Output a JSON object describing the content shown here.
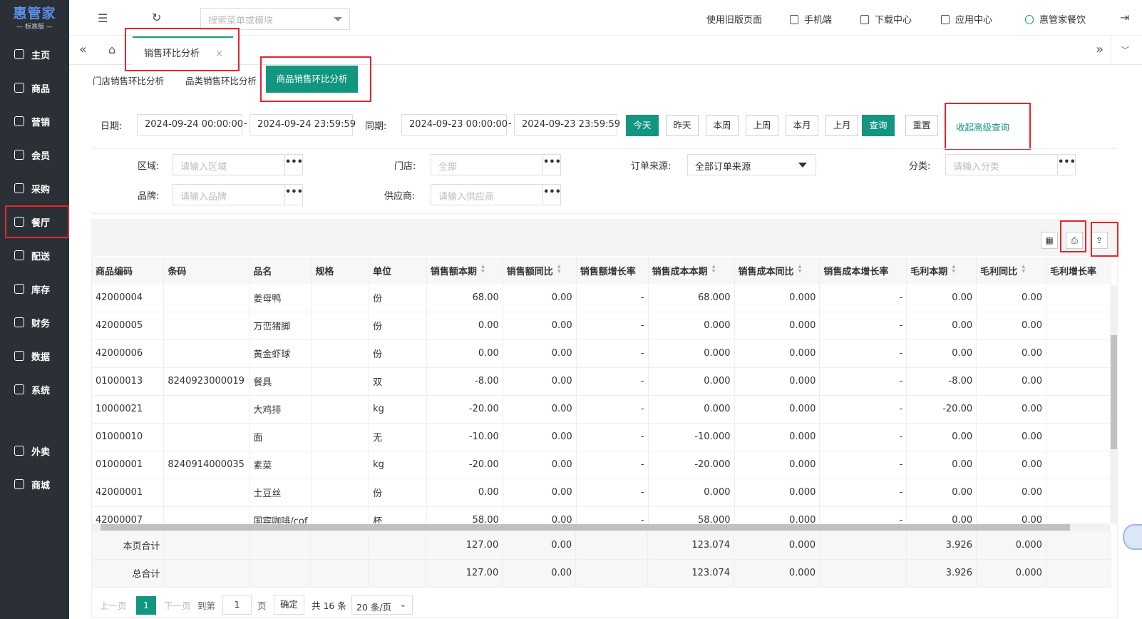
{
  "sidebar": {
    "logo_main": "惠管家",
    "logo_sub": "— 标准版 —",
    "items": [
      {
        "label": "主页",
        "icon": "home-icon"
      },
      {
        "label": "商品",
        "icon": "box-icon"
      },
      {
        "label": "营销",
        "icon": "chart-icon"
      },
      {
        "label": "会员",
        "icon": "diamond-icon"
      },
      {
        "label": "采购",
        "icon": "cart-icon"
      },
      {
        "label": "餐厅",
        "icon": "cloche-icon"
      },
      {
        "label": "配送",
        "icon": "truck-icon"
      },
      {
        "label": "库存",
        "icon": "warehouse-icon"
      },
      {
        "label": "财务",
        "icon": "wallet-icon"
      },
      {
        "label": "数据",
        "icon": "bar-chart-icon"
      },
      {
        "label": "系统",
        "icon": "gear-icon"
      },
      {
        "label": "外卖",
        "icon": "scooter-icon"
      },
      {
        "label": "商城",
        "icon": "store-icon"
      }
    ]
  },
  "topbar": {
    "search_placeholder": "搜索菜单或模块",
    "links": [
      "使用旧版页面",
      "手机端",
      "下载中心",
      "应用中心",
      "惠管家餐饮"
    ]
  },
  "tabs": {
    "active": "销售环比分析",
    "close": "×"
  },
  "subtabs": [
    "门店销售环比分析",
    "品类销售环比分析",
    "商品销售环比分析"
  ],
  "filters": {
    "date_label": "日期:",
    "date_start": "2024-09-24 00:00:00",
    "date_end": "2024-09-24 23:59:59",
    "same_label": "同期:",
    "same_start": "2024-09-23 00:00:00",
    "same_end": "2024-09-23 23:59:59",
    "dash": "-",
    "quick": [
      "今天",
      "昨天",
      "本周",
      "上周",
      "本月",
      "上月"
    ],
    "query": "查询",
    "reset": "重置",
    "advanced": "收起高级查询",
    "region_label": "区域:",
    "region_ph": "请输入区域",
    "store_label": "门店:",
    "store_ph": "全部",
    "source_label": "订单来源:",
    "source_value": "全部订单来源",
    "category_label": "分类:",
    "category_ph": "请输入分类",
    "brand_label": "品牌:",
    "brand_ph": "请输入品牌",
    "supplier_label": "供应商:",
    "supplier_ph": "请输入供应商",
    "more": "•••"
  },
  "table": {
    "headers": [
      "商品编码",
      "条码",
      "品名",
      "规格",
      "单位",
      "销售额本期",
      "销售额同比",
      "销售额增长率",
      "销售成本本期",
      "销售成本同比",
      "销售成本增长率",
      "毛利本期",
      "毛利同比",
      "毛利增长率"
    ],
    "rows": [
      [
        "42000004",
        "",
        "姜母鸭",
        "",
        "份",
        "68.00",
        "0.00",
        "-",
        "68.000",
        "0.000",
        "-",
        "0.00",
        "0.00"
      ],
      [
        "42000005",
        "",
        "万峦猪脚",
        "",
        "份",
        "0.00",
        "0.00",
        "-",
        "0.000",
        "0.000",
        "-",
        "0.00",
        "0.00"
      ],
      [
        "42000006",
        "",
        "黄金虾球",
        "",
        "份",
        "0.00",
        "0.00",
        "-",
        "0.000",
        "0.000",
        "-",
        "0.00",
        "0.00"
      ],
      [
        "01000013",
        "8240923000019",
        "餐具",
        "",
        "双",
        "-8.00",
        "0.00",
        "-",
        "0.000",
        "0.000",
        "-",
        "-8.00",
        "0.00"
      ],
      [
        "10000021",
        "",
        "大鸡排",
        "",
        "kg",
        "-20.00",
        "0.00",
        "-",
        "0.000",
        "0.000",
        "-",
        "-20.00",
        "0.00"
      ],
      [
        "01000010",
        "",
        "面",
        "",
        "无",
        "-10.00",
        "0.00",
        "-",
        "-10.000",
        "0.000",
        "-",
        "0.00",
        "0.00"
      ],
      [
        "01000001",
        "8240914000035",
        "素菜",
        "",
        "kg",
        "-20.00",
        "0.00",
        "-",
        "-20.000",
        "0.000",
        "-",
        "0.00",
        "0.00"
      ],
      [
        "42000001",
        "",
        "土豆丝",
        "",
        "份",
        "0.00",
        "0.00",
        "-",
        "0.000",
        "0.000",
        "-",
        "0.00",
        "0.00"
      ],
      [
        "42000007",
        "",
        "国宾咖啡/cof",
        "",
        "杯",
        "58.00",
        "0.00",
        "-",
        "58.000",
        "0.000",
        "-",
        "0.00",
        "0.00"
      ]
    ],
    "page_total_label": "本页合计",
    "page_total": [
      "127.00",
      "0.00",
      "123.074",
      "0.000",
      "3.926",
      "0.000"
    ],
    "grand_total_label": "总合计",
    "grand_total": [
      "127.00",
      "0.00",
      "123.074",
      "0.000",
      "3.926",
      "0.000"
    ]
  },
  "pager": {
    "prev": "上一页",
    "page": "1",
    "next": "下一页",
    "goto": "到第",
    "goto_value": "1",
    "page_unit": "页",
    "confirm": "确定",
    "total": "共 16 条",
    "size": "20 条/页"
  }
}
